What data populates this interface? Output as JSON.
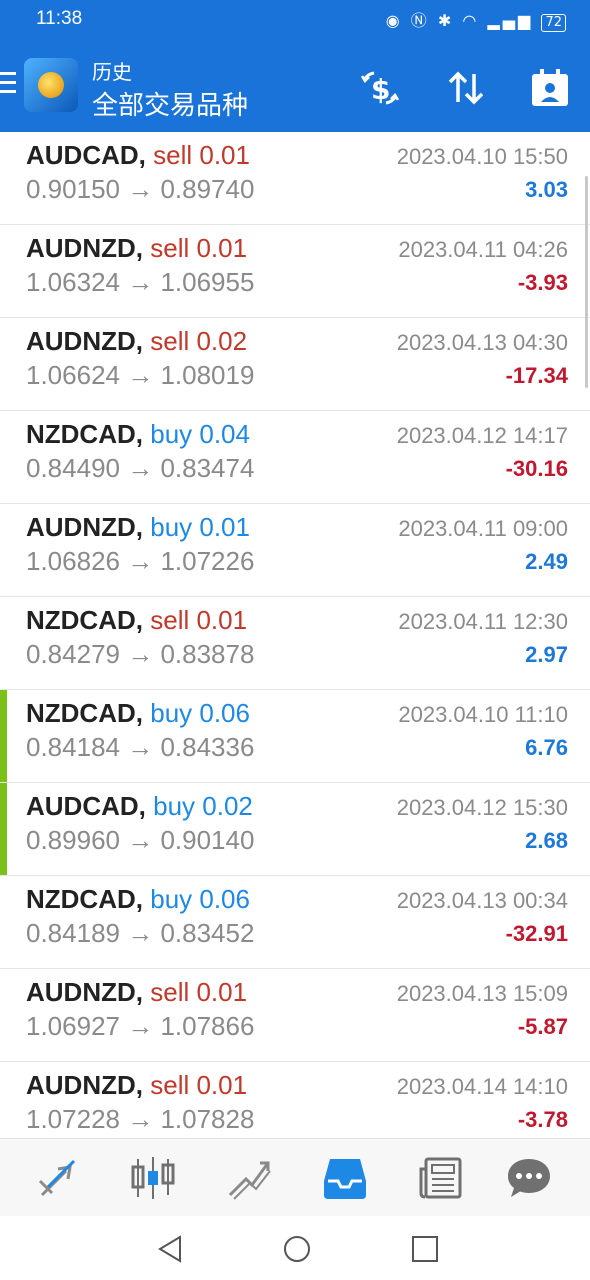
{
  "status": {
    "time": "11:38",
    "battery": "72"
  },
  "appbar": {
    "subtitle": "历史",
    "title": "全部交易品种"
  },
  "colors": {
    "primary": "#1a73d9",
    "sell": "#c0392b",
    "buy": "#1e88e5",
    "profit_pos": "#1e78d8",
    "profit_neg": "#c0182e",
    "marker": "#7cc11a"
  },
  "icons": {
    "menu": "menu-icon",
    "logo": "app-logo",
    "dollar": "dollar-exchange-icon",
    "sort": "sort-icon",
    "calendar": "calendar-user-icon"
  },
  "trades": [
    {
      "symbol": "AUDCAD,",
      "type": "sell 0.01",
      "dir": "sell",
      "open": "0.90150",
      "arrow": "→",
      "close": "0.89740",
      "time": "2023.04.10 15:50",
      "profit": "3.03",
      "sign": "pos",
      "marker": false
    },
    {
      "symbol": "AUDNZD,",
      "type": "sell 0.01",
      "dir": "sell",
      "open": "1.06324",
      "arrow": "→",
      "close": "1.06955",
      "time": "2023.04.11 04:26",
      "profit": "-3.93",
      "sign": "neg",
      "marker": false
    },
    {
      "symbol": "AUDNZD,",
      "type": "sell 0.02",
      "dir": "sell",
      "open": "1.06624",
      "arrow": "→",
      "close": "1.08019",
      "time": "2023.04.13 04:30",
      "profit": "-17.34",
      "sign": "neg",
      "marker": false
    },
    {
      "symbol": "NZDCAD,",
      "type": "buy 0.04",
      "dir": "buy",
      "open": "0.84490",
      "arrow": "→",
      "close": "0.83474",
      "time": "2023.04.12 14:17",
      "profit": "-30.16",
      "sign": "neg",
      "marker": false
    },
    {
      "symbol": "AUDNZD,",
      "type": "buy 0.01",
      "dir": "buy",
      "open": "1.06826",
      "arrow": "→",
      "close": "1.07226",
      "time": "2023.04.11 09:00",
      "profit": "2.49",
      "sign": "pos",
      "marker": false
    },
    {
      "symbol": "NZDCAD,",
      "type": "sell 0.01",
      "dir": "sell",
      "open": "0.84279",
      "arrow": "→",
      "close": "0.83878",
      "time": "2023.04.11 12:30",
      "profit": "2.97",
      "sign": "pos",
      "marker": false
    },
    {
      "symbol": "NZDCAD,",
      "type": "buy 0.06",
      "dir": "buy",
      "open": "0.84184",
      "arrow": "→",
      "close": "0.84336",
      "time": "2023.04.10 11:10",
      "profit": "6.76",
      "sign": "pos",
      "marker": true
    },
    {
      "symbol": "AUDCAD,",
      "type": "buy 0.02",
      "dir": "buy",
      "open": "0.89960",
      "arrow": "→",
      "close": "0.90140",
      "time": "2023.04.12 15:30",
      "profit": "2.68",
      "sign": "pos",
      "marker": true
    },
    {
      "symbol": "NZDCAD,",
      "type": "buy 0.06",
      "dir": "buy",
      "open": "0.84189",
      "arrow": "→",
      "close": "0.83452",
      "time": "2023.04.13 00:34",
      "profit": "-32.91",
      "sign": "neg",
      "marker": false
    },
    {
      "symbol": "AUDNZD,",
      "type": "sell 0.01",
      "dir": "sell",
      "open": "1.06927",
      "arrow": "→",
      "close": "1.07866",
      "time": "2023.04.13 15:09",
      "profit": "-5.87",
      "sign": "neg",
      "marker": false
    },
    {
      "symbol": "AUDNZD,",
      "type": "sell 0.01",
      "dir": "sell",
      "open": "1.07228",
      "arrow": "→",
      "close": "1.07828",
      "time": "2023.04.14 14:10",
      "profit": "-3.78",
      "sign": "neg",
      "marker": false
    }
  ],
  "tabs": [
    {
      "name": "tab-quotes",
      "icon": "quotes-arrows-icon",
      "active": false
    },
    {
      "name": "tab-chart",
      "icon": "candlestick-icon",
      "active": false
    },
    {
      "name": "tab-trade",
      "icon": "trend-lines-icon",
      "active": false
    },
    {
      "name": "tab-history",
      "icon": "inbox-tray-icon",
      "active": true
    },
    {
      "name": "tab-news",
      "icon": "newspaper-icon",
      "active": false
    },
    {
      "name": "tab-messages",
      "icon": "chat-bubble-icon",
      "active": false
    }
  ],
  "nav": {
    "back": "back-triangle-icon",
    "home": "home-circle-icon",
    "recents": "recents-square-icon"
  }
}
